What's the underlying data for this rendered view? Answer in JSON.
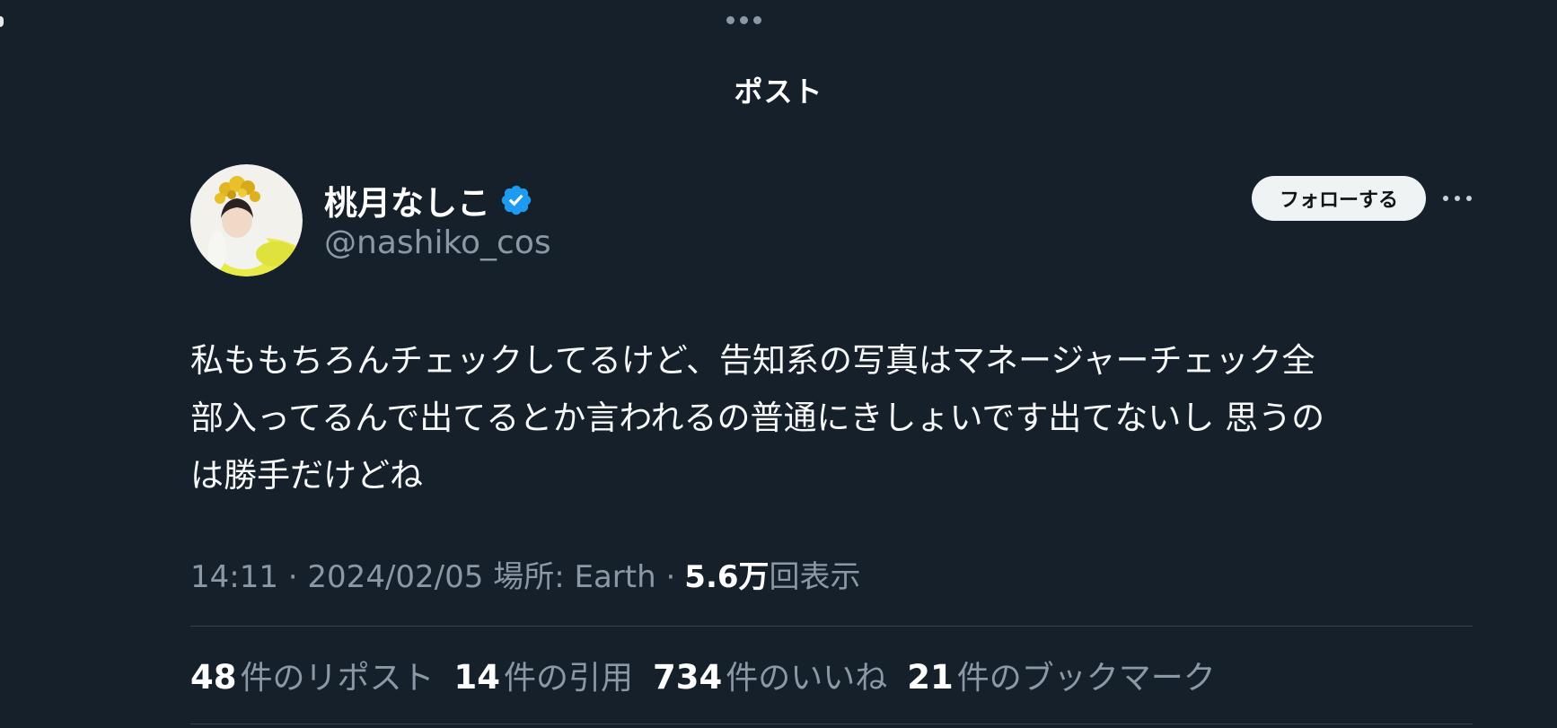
{
  "screen": {
    "title": "ポスト"
  },
  "author": {
    "display_name": "桃月なしこ",
    "handle": "@nashiko_cos",
    "verified": true,
    "verified_color": "#1d9bf0",
    "avatar_icon": "avatar-photo-icon"
  },
  "actions": {
    "follow_label": "フォローする",
    "more_icon": "more-horizontal-icon"
  },
  "post": {
    "text_lines": [
      "私ももちろんチェックしてるけど、告知系の写真はマネージャーチェック全",
      "部入ってるんで出てるとか言われるの普通にきしょいです出てないし 思うの",
      "は勝手だけどね"
    ]
  },
  "meta": {
    "time": "14:11",
    "date": "2024/02/05",
    "location": "場所: Earth",
    "separator": "·",
    "views_count": "5.6万",
    "views_label": "回表示"
  },
  "stats": [
    {
      "count": "48",
      "label": "件のリポスト"
    },
    {
      "count": "14",
      "label": "件の引用"
    },
    {
      "count": "734",
      "label": "件のいいね"
    },
    {
      "count": "21",
      "label": "件のブックマーク"
    }
  ],
  "colors": {
    "background": "#15202b",
    "primary_text": "#ffffff",
    "secondary_text": "#8b98a5",
    "divider": "#38444d",
    "follow_button_bg": "#eff3f4"
  }
}
